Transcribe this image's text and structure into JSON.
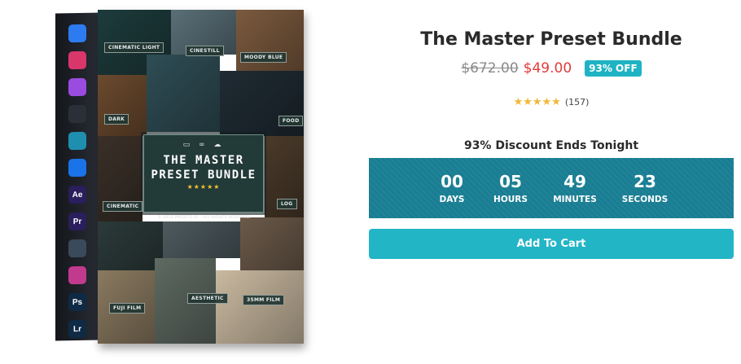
{
  "product": {
    "title": "The Master Preset Bundle",
    "old_price": "$672.00",
    "new_price": "$49.00",
    "discount_badge": "93% OFF",
    "rating_stars": "★★★★★",
    "rating_value": 5,
    "review_count": "(157)"
  },
  "countdown": {
    "heading": "93% Discount Ends Tonight",
    "units": [
      {
        "value": "00",
        "label": "DAYS"
      },
      {
        "value": "05",
        "label": "HOURS"
      },
      {
        "value": "49",
        "label": "MINUTES"
      },
      {
        "value": "23",
        "label": "SECONDS"
      }
    ]
  },
  "cart": {
    "label": "Add To Cart"
  },
  "box_image": {
    "plate_icons": "▭ ∞ ☁",
    "plate_title_line1": "THE MASTER",
    "plate_title_line2": "PRESET BUNDLE",
    "plate_stars": "★★★★★",
    "copyright": "© 2023 PRESETS.IO - ALL RIGHTS RESERVED.",
    "tile_labels": [
      "CINEMATIC LIGHT",
      "CINESTILL",
      "MOODY BLUE",
      "DARK",
      "FOOD",
      "CINEMATIC",
      "LOG",
      "FUJI FILM",
      "AESTHETIC",
      "35MM FILM"
    ],
    "side_apps": [
      {
        "name": "lightroom-mobile-icon",
        "text": "",
        "color": "#2d7bf0"
      },
      {
        "name": "photos-icon",
        "text": "",
        "color": "#d9366b"
      },
      {
        "name": "premiere-rush-icon",
        "text": "",
        "color": "#9a4be0"
      },
      {
        "name": "capcut-icon",
        "text": "",
        "color": "#2b2f37"
      },
      {
        "name": "vn-icon",
        "text": "",
        "color": "#1f8fb0"
      },
      {
        "name": "play-icon",
        "text": "",
        "color": "#1a73e8"
      },
      {
        "name": "after-effects-icon",
        "text": "Ae",
        "color": "#2a1e5c"
      },
      {
        "name": "premiere-pro-icon",
        "text": "Pr",
        "color": "#2a1e5c"
      },
      {
        "name": "davinci-resolve-icon",
        "text": "",
        "color": "#3a4a5a"
      },
      {
        "name": "final-cut-icon",
        "text": "",
        "color": "#c23a8e"
      },
      {
        "name": "photoshop-icon",
        "text": "Ps",
        "color": "#0f2a44"
      },
      {
        "name": "lightroom-icon",
        "text": "Lr",
        "color": "#0f2a44"
      }
    ]
  },
  "colors": {
    "accent": "#22b5c6",
    "countdown_bg": "#197e93",
    "sale_price": "#e23b3b",
    "star": "#f3b637"
  }
}
